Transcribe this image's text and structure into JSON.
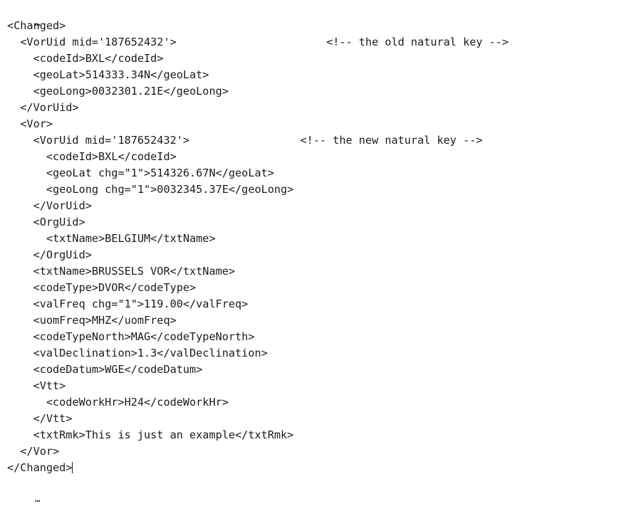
{
  "document": {
    "kind": "xml-code-listing",
    "background_color": "#ffffff",
    "text_color": "#1b1b1b",
    "truncation_top": "…",
    "truncation_bottom": "…",
    "caret_after_line_index": 29
  },
  "lines": [
    {
      "text": "<Changed>",
      "comment": "",
      "comment_col": 0
    },
    {
      "text": "  <VorUid mid='187652432'>",
      "comment": "<!-- the old natural key -->",
      "comment_col": 49
    },
    {
      "text": "    <codeId>BXL</codeId>",
      "comment": "",
      "comment_col": 0
    },
    {
      "text": "    <geoLat>514333.34N</geoLat>",
      "comment": "",
      "comment_col": 0
    },
    {
      "text": "    <geoLong>0032301.21E</geoLong>",
      "comment": "",
      "comment_col": 0
    },
    {
      "text": "  </VorUid>",
      "comment": "",
      "comment_col": 0
    },
    {
      "text": "  <Vor>",
      "comment": "",
      "comment_col": 0
    },
    {
      "text": "    <VorUid mid='187652432'>",
      "comment": "<!-- the new natural key -->",
      "comment_col": 45
    },
    {
      "text": "      <codeId>BXL</codeId>",
      "comment": "",
      "comment_col": 0
    },
    {
      "text": "      <geoLat chg=\"1\">514326.67N</geoLat>",
      "comment": "",
      "comment_col": 0
    },
    {
      "text": "      <geoLong chg=\"1\">0032345.37E</geoLong>",
      "comment": "",
      "comment_col": 0
    },
    {
      "text": "    </VorUid>",
      "comment": "",
      "comment_col": 0
    },
    {
      "text": "    <OrgUid>",
      "comment": "",
      "comment_col": 0
    },
    {
      "text": "      <txtName>BELGIUM</txtName>",
      "comment": "",
      "comment_col": 0
    },
    {
      "text": "    </OrgUid>",
      "comment": "",
      "comment_col": 0
    },
    {
      "text": "    <txtName>BRUSSELS VOR</txtName>",
      "comment": "",
      "comment_col": 0
    },
    {
      "text": "    <codeType>DVOR</codeType>",
      "comment": "",
      "comment_col": 0
    },
    {
      "text": "    <valFreq chg=\"1\">119.00</valFreq>",
      "comment": "",
      "comment_col": 0
    },
    {
      "text": "    <uomFreq>MHZ</uomFreq>",
      "comment": "",
      "comment_col": 0
    },
    {
      "text": "    <codeTypeNorth>MAG</codeTypeNorth>",
      "comment": "",
      "comment_col": 0
    },
    {
      "text": "    <valDeclination>1.3</valDeclination>",
      "comment": "",
      "comment_col": 0
    },
    {
      "text": "    <codeDatum>WGE</codeDatum>",
      "comment": "",
      "comment_col": 0
    },
    {
      "text": "    <Vtt>",
      "comment": "",
      "comment_col": 0
    },
    {
      "text": "      <codeWorkHr>H24</codeWorkHr>",
      "comment": "",
      "comment_col": 0
    },
    {
      "text": "    </Vtt>",
      "comment": "",
      "comment_col": 0
    },
    {
      "text": "    <txtRmk>This is just an example</txtRmk>",
      "comment": "",
      "comment_col": 0
    },
    {
      "text": "  </Vor>",
      "comment": "",
      "comment_col": 0
    },
    {
      "text": "</Changed>",
      "comment": "",
      "comment_col": 0
    }
  ]
}
